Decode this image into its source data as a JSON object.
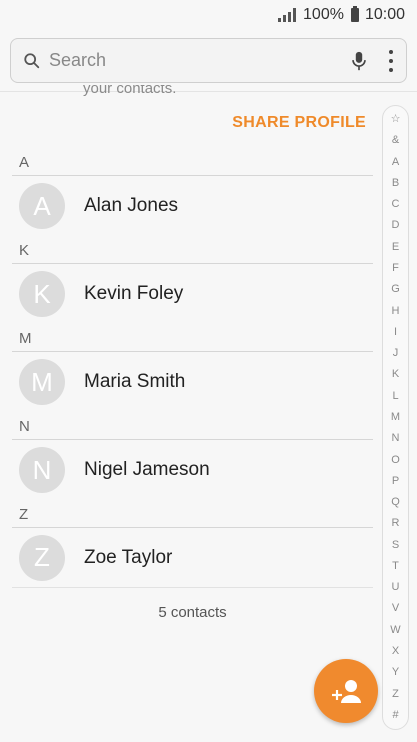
{
  "status_bar": {
    "battery_percent": "100%",
    "time": "10:00"
  },
  "search": {
    "placeholder": "Search"
  },
  "profile": {
    "cut_text": "your contacts.",
    "share_label": "SHARE PROFILE"
  },
  "sections": [
    {
      "letter": "A",
      "contacts": [
        {
          "initial": "A",
          "name": "Alan Jones"
        }
      ]
    },
    {
      "letter": "K",
      "contacts": [
        {
          "initial": "K",
          "name": "Kevin Foley"
        }
      ]
    },
    {
      "letter": "M",
      "contacts": [
        {
          "initial": "M",
          "name": "Maria Smith"
        }
      ]
    },
    {
      "letter": "N",
      "contacts": [
        {
          "initial": "N",
          "name": "Nigel Jameson"
        }
      ]
    },
    {
      "letter": "Z",
      "contacts": [
        {
          "initial": "Z",
          "name": "Zoe Taylor"
        }
      ]
    }
  ],
  "contact_count": "5 contacts",
  "index_letters": [
    "☆",
    "&",
    "A",
    "B",
    "C",
    "D",
    "E",
    "F",
    "G",
    "H",
    "I",
    "J",
    "K",
    "L",
    "M",
    "N",
    "O",
    "P",
    "Q",
    "R",
    "S",
    "T",
    "U",
    "V",
    "W",
    "X",
    "Y",
    "Z",
    "#"
  ],
  "colors": {
    "accent": "#ef8a2a",
    "avatar_bg": "#dcdcdc"
  },
  "icons": {
    "search": "search-icon",
    "mic": "microphone-icon",
    "more": "more-options-icon",
    "fab": "add-contact-icon"
  }
}
